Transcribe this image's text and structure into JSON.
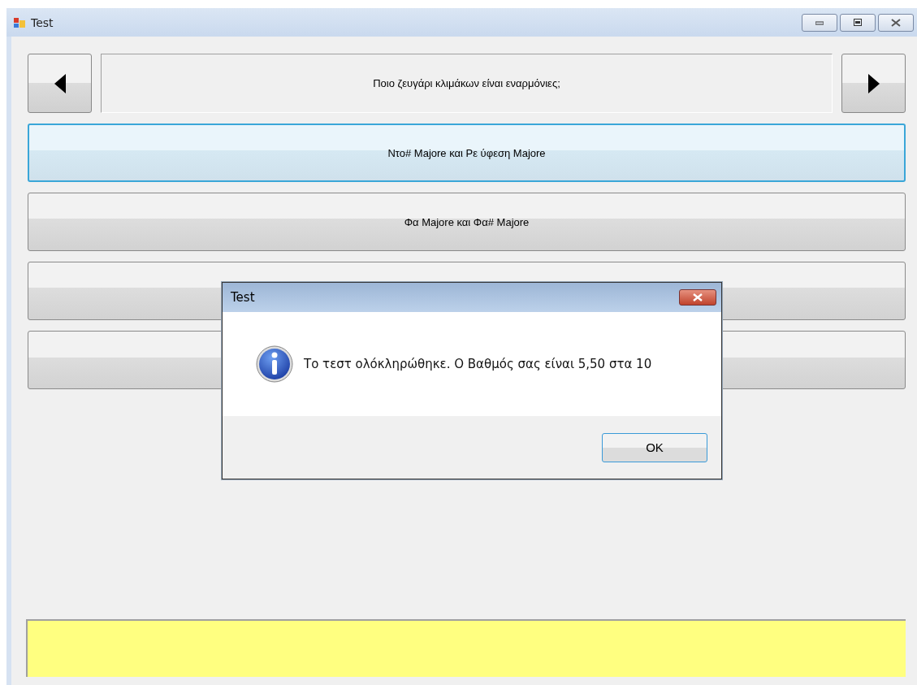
{
  "window": {
    "title": "Test"
  },
  "question": "Ποιο ζευγάρι κλιμάκων είναι εναρμόνιες;",
  "answers": [
    {
      "label": "Ντο# Majore και Ρε ύφεση Majore",
      "focused": true
    },
    {
      "label": "Φα Majore και Φα# Majore",
      "focused": false
    },
    {
      "focused": false
    },
    {
      "focused": false
    }
  ],
  "dialog": {
    "title": "Test",
    "message": "Το τεστ ολόκληρώθηκε. Ο Βαθμός σας είναι 5,50 στα 10",
    "button": "OK"
  }
}
